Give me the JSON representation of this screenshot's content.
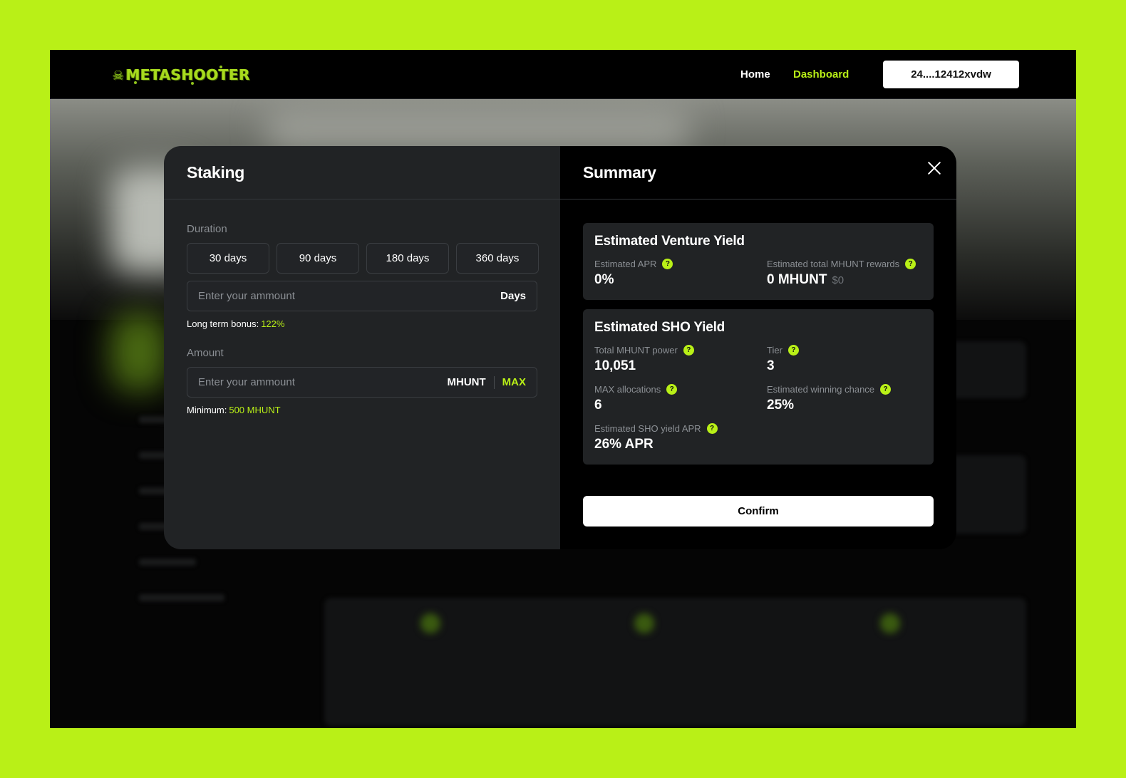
{
  "header": {
    "logo_text": "METASHOOTER",
    "nav": [
      {
        "label": "Home"
      },
      {
        "label": "Dashboard"
      }
    ],
    "wallet_label": "24....12412xvdw"
  },
  "staking": {
    "title": "Staking",
    "duration_label": "Duration",
    "durations": [
      "30 days",
      "90 days",
      "180 days",
      "360 days"
    ],
    "days_input": {
      "placeholder": "Enter your ammount",
      "unit": "Days"
    },
    "bonus": {
      "label": "Long term bonus:",
      "value": "122%"
    },
    "amount_label": "Amount",
    "amount_input": {
      "placeholder": "Enter your ammount",
      "unit": "MHUNT",
      "max_label": "MAX"
    },
    "minimum": {
      "label": "Minimum:",
      "value": "500 MHUNT"
    }
  },
  "summary": {
    "title": "Summary",
    "venture": {
      "title": "Estimated Venture Yield",
      "apr_label": "Estimated APR",
      "apr_value": "0%",
      "rewards_label": "Estimated total MHUNT rewards",
      "rewards_value": "0 MHUNT",
      "rewards_usd": "$0"
    },
    "sho": {
      "title": "Estimated SHO Yield",
      "power_label": "Total MHUNT power",
      "power_value": "10,051",
      "tier_label": "Tier",
      "tier_value": "3",
      "alloc_label": "MAX allocations",
      "alloc_value": "6",
      "chance_label": "Estimated winning chance",
      "chance_value": "25%",
      "apr_label": "Estimated SHO yield APR",
      "apr_value": "26% APR"
    },
    "confirm_label": "Confirm"
  },
  "colors": {
    "accent": "#b9f017",
    "panel": "#212325",
    "background": "#000000"
  }
}
